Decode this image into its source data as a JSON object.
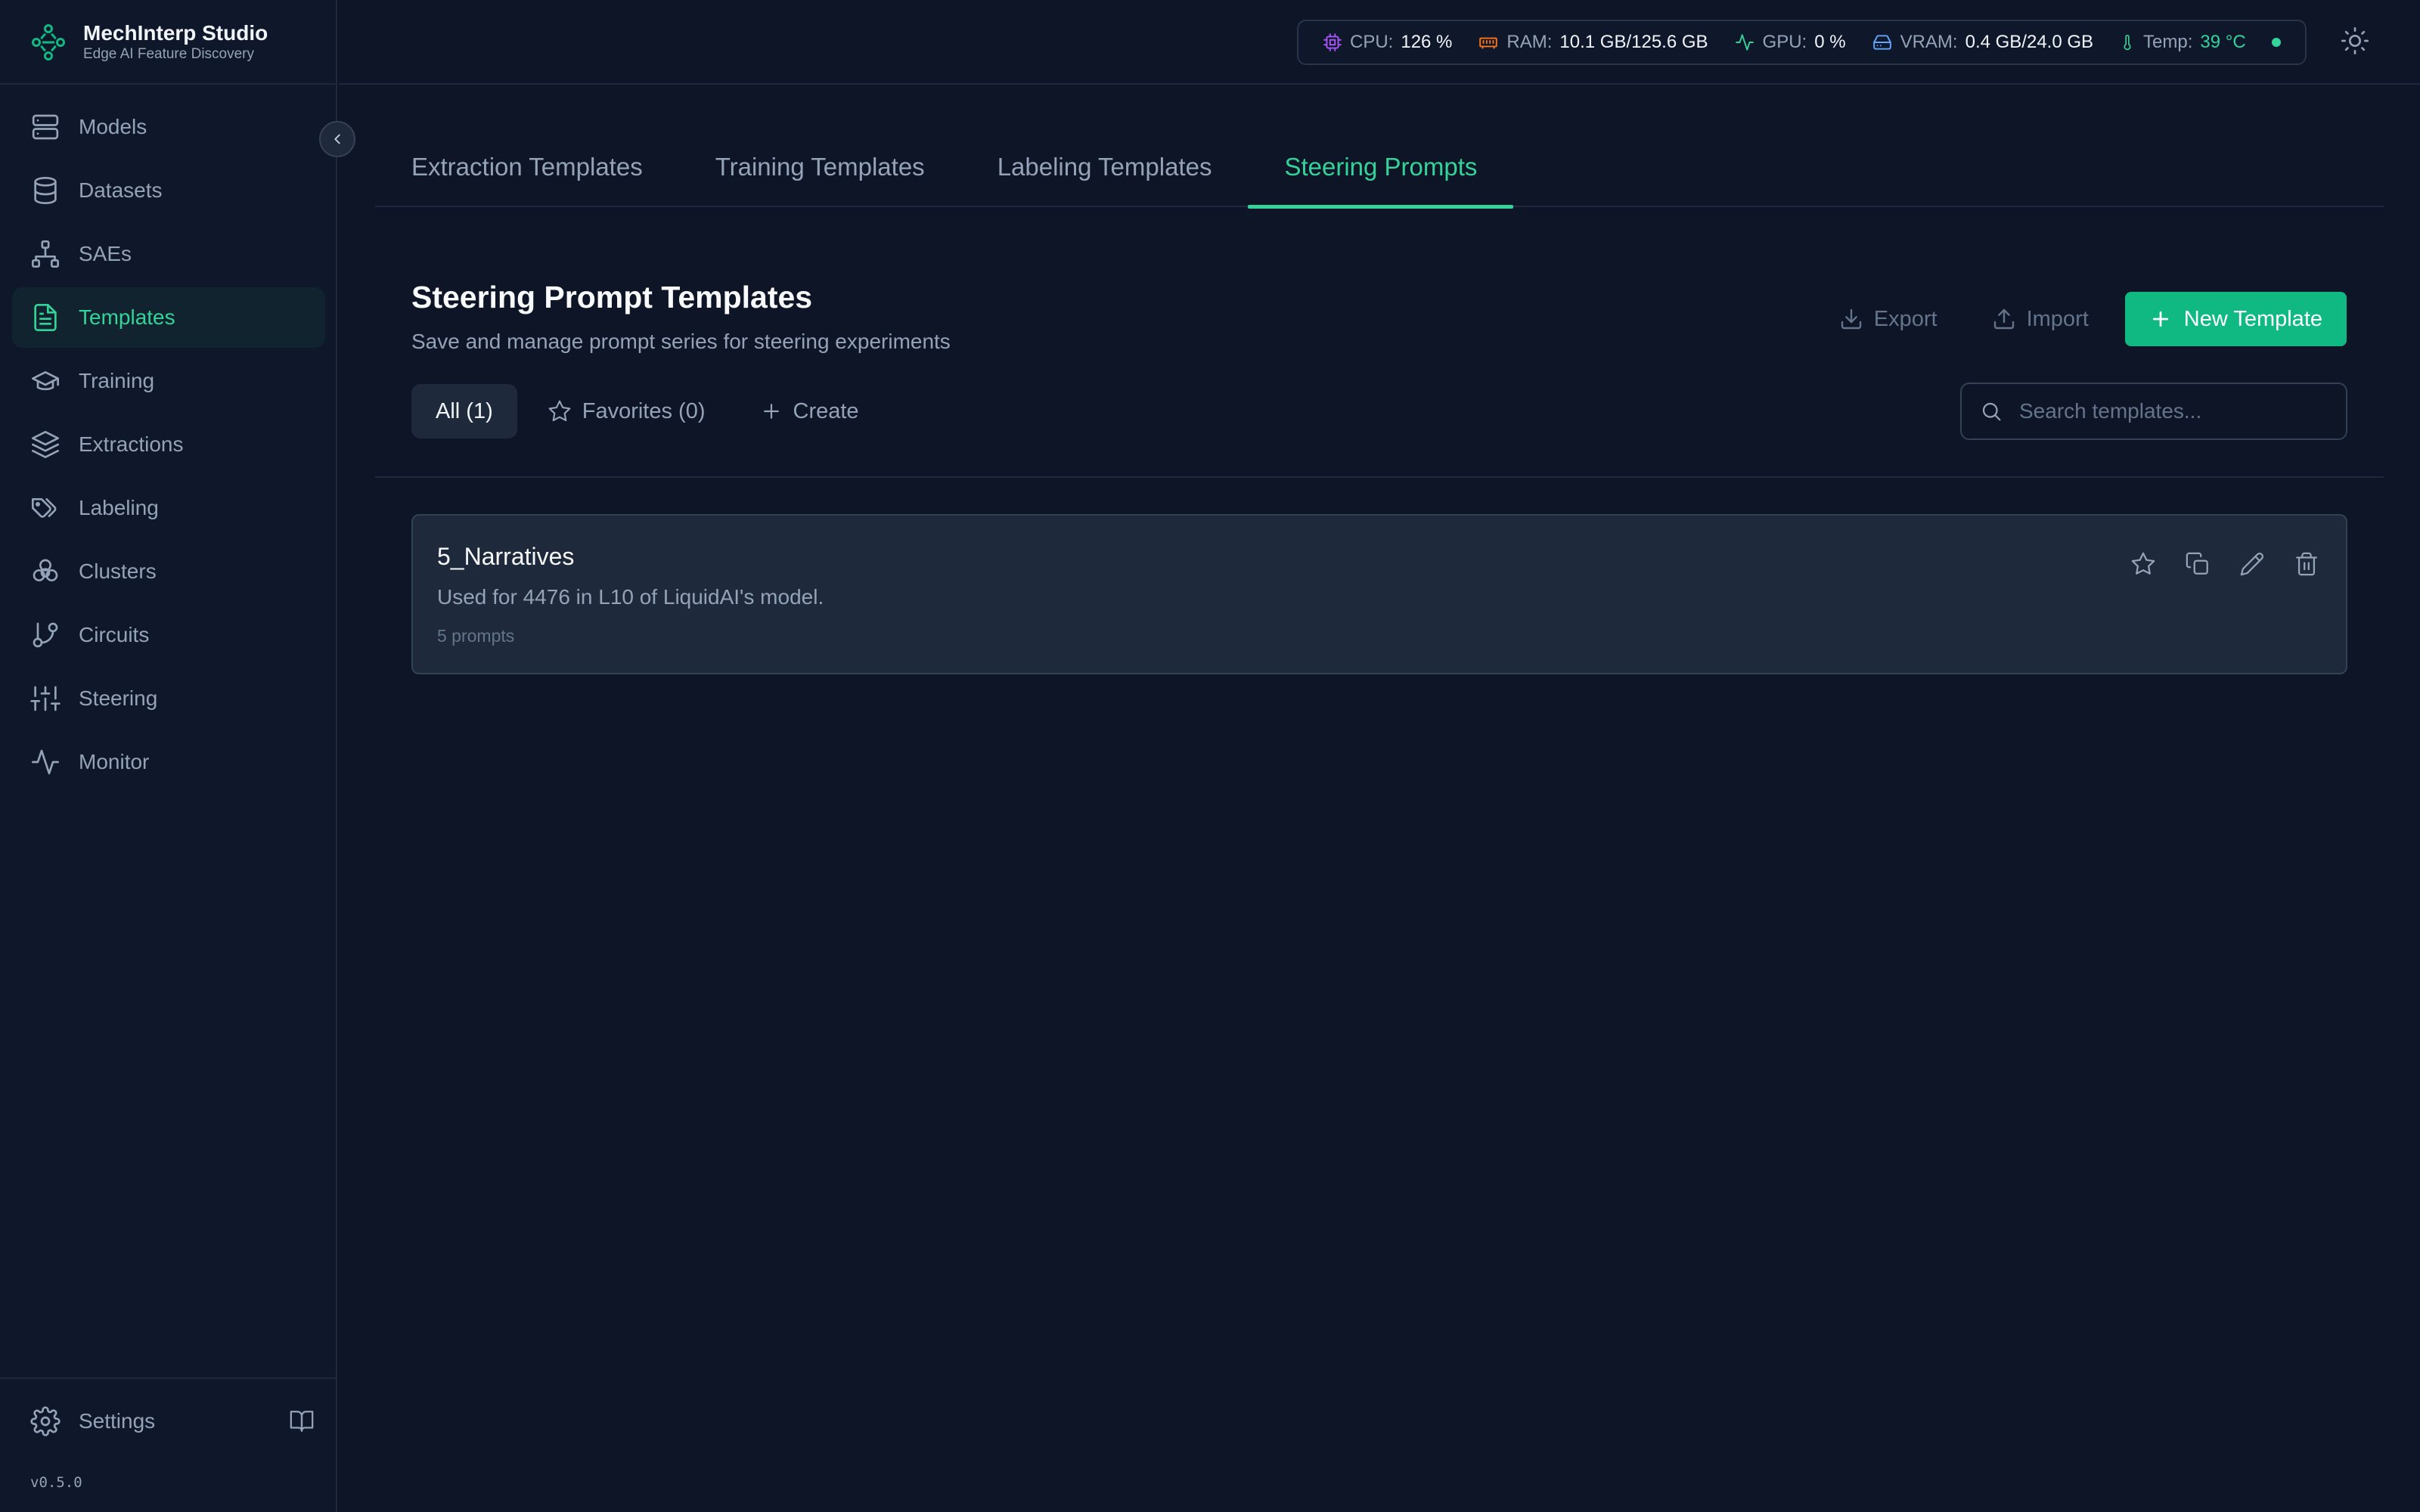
{
  "app": {
    "title": "MechInterp Studio",
    "subtitle": "Edge AI Feature Discovery",
    "version": "v0.5.0",
    "accent_color": "#10b981"
  },
  "sidebar": {
    "items": [
      {
        "label": "Models",
        "icon": "server-icon"
      },
      {
        "label": "Datasets",
        "icon": "database-icon"
      },
      {
        "label": "SAEs",
        "icon": "network-icon"
      },
      {
        "label": "Templates",
        "icon": "file-text-icon",
        "active": true
      },
      {
        "label": "Training",
        "icon": "graduation-cap-icon"
      },
      {
        "label": "Extractions",
        "icon": "layers-icon"
      },
      {
        "label": "Labeling",
        "icon": "tags-icon"
      },
      {
        "label": "Clusters",
        "icon": "circles-icon"
      },
      {
        "label": "Circuits",
        "icon": "git-branch-icon"
      },
      {
        "label": "Steering",
        "icon": "sliders-icon"
      },
      {
        "label": "Monitor",
        "icon": "activity-icon"
      }
    ],
    "settings_label": "Settings"
  },
  "system_stats": {
    "cpu": {
      "label": "CPU:",
      "value": "126 %"
    },
    "ram": {
      "label": "RAM:",
      "value": "10.1 GB/125.6 GB"
    },
    "gpu": {
      "label": "GPU:",
      "value": "0 %"
    },
    "vram": {
      "label": "VRAM:",
      "value": "0.4 GB/24.0 GB"
    },
    "temp": {
      "label": "Temp:",
      "value": "39 °C"
    }
  },
  "tabs": [
    {
      "label": "Extraction Templates"
    },
    {
      "label": "Training Templates"
    },
    {
      "label": "Labeling Templates"
    },
    {
      "label": "Steering Prompts",
      "active": true
    }
  ],
  "section": {
    "title": "Steering Prompt Templates",
    "subtitle": "Save and manage prompt series for steering experiments",
    "export_label": "Export",
    "import_label": "Import",
    "new_label": "New Template"
  },
  "filters": {
    "all_label": "All (1)",
    "favorites_label": "Favorites (0)",
    "create_label": "Create"
  },
  "search": {
    "placeholder": "Search templates...",
    "value": ""
  },
  "templates": [
    {
      "name": "5_Narratives",
      "description": "Used for 4476 in L10 of LiquidAI's model.",
      "meta": "5 prompts"
    }
  ]
}
